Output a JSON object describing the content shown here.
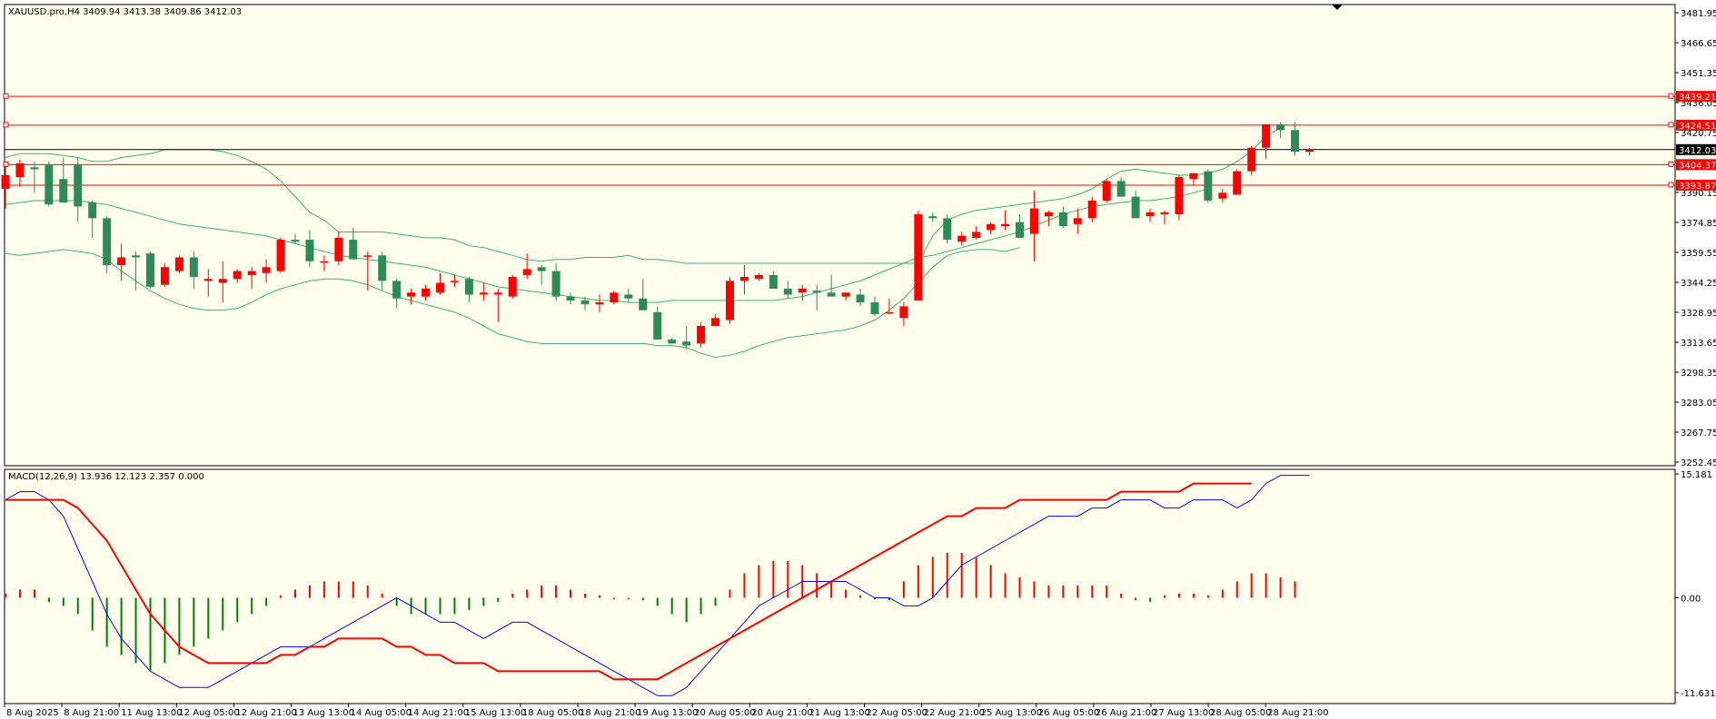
{
  "colors": {
    "background": "#FFFFEE",
    "bull": "#FF0000",
    "bear": "#2E8B57",
    "bands": "#3CB371",
    "macd_line": "#0000FF",
    "signal_line": "#FF0000",
    "hist_pos": "#FF0000",
    "hist_neg": "#008000",
    "level_line": "#FF0000",
    "current_price_line": "#000000"
  },
  "header": {
    "text": "XAUUSD.pro,H4  3409.94 3413.38 3409.86 3412.03"
  },
  "macd_header": {
    "text": "MACD(12,26,9) 13.936 12.123 2.357 0.000"
  },
  "price_axis": {
    "ticks": [
      "3481.95",
      "3466.65",
      "3451.35",
      "3436.05",
      "3420.75",
      "3405.45",
      "3390.15",
      "3374.85",
      "3359.55",
      "3344.25",
      "3328.95",
      "3313.65",
      "3298.35",
      "3283.05",
      "3267.75",
      "3252.45"
    ],
    "ylim": [
      3252.45,
      3481.95
    ]
  },
  "price_labels": {
    "current": "3412.03",
    "levels": [
      "3439.21",
      "3424.51",
      "3404.37",
      "3393.87"
    ]
  },
  "macd_axis": {
    "ticks": [
      "15.181",
      "0.00",
      "-11.631"
    ],
    "ylim": [
      -11.631,
      15.181
    ]
  },
  "time_axis": {
    "labels": [
      "8 Aug 2025",
      "8 Aug 21:00",
      "11 Aug 13:00",
      "12 Aug 05:00",
      "12 Aug 21:00",
      "13 Aug 13:00",
      "14 Aug 05:00",
      "14 Aug 21:00",
      "15 Aug 13:00",
      "18 Aug 05:00",
      "18 Aug 21:00",
      "19 Aug 13:00",
      "20 Aug 05:00",
      "20 Aug 21:00",
      "21 Aug 13:00",
      "22 Aug 05:00",
      "22 Aug 21:00",
      "25 Aug 13:00",
      "26 Aug 05:00",
      "26 Aug 21:00",
      "27 Aug 13:00",
      "28 Aug 05:00",
      "28 Aug 21:00"
    ]
  },
  "chart_data": {
    "type": "candlestick",
    "symbol": "XAUUSD.pro",
    "timeframe": "H4",
    "last_ohlc": [
      3409.94,
      3413.38,
      3409.86,
      3412.03
    ],
    "candles": [
      [
        3392,
        3404,
        3382,
        3399
      ],
      [
        3398,
        3407,
        3393,
        3405
      ],
      [
        3403,
        3406,
        3390,
        3402
      ],
      [
        3404,
        3406,
        3383,
        3384
      ],
      [
        3397,
        3408,
        3385,
        3385
      ],
      [
        3404,
        3408,
        3375,
        3383
      ],
      [
        3385,
        3386,
        3367,
        3377
      ],
      [
        3377,
        3378,
        3349,
        3353
      ],
      [
        3353,
        3364,
        3345,
        3357
      ],
      [
        3358,
        3360,
        3340,
        3357
      ],
      [
        3359,
        3360,
        3341,
        3342
      ],
      [
        3343,
        3354,
        3342,
        3352
      ],
      [
        3350,
        3358,
        3349,
        3357
      ],
      [
        3357,
        3360,
        3341,
        3347
      ],
      [
        3345,
        3351,
        3337,
        3346
      ],
      [
        3344,
        3355,
        3334,
        3346
      ],
      [
        3346,
        3351,
        3344,
        3350
      ],
      [
        3348,
        3352,
        3341,
        3350
      ],
      [
        3349,
        3356,
        3344,
        3352
      ],
      [
        3350,
        3367,
        3349,
        3366
      ],
      [
        3366,
        3369,
        3364,
        3365
      ],
      [
        3366,
        3371,
        3352,
        3355
      ],
      [
        3355,
        3358,
        3350,
        3355
      ],
      [
        3355,
        3370,
        3353,
        3367
      ],
      [
        3366,
        3372,
        3361,
        3356
      ],
      [
        3358,
        3360,
        3340,
        3358
      ],
      [
        3358,
        3360,
        3340,
        3345
      ],
      [
        3345,
        3346,
        3331,
        3336
      ],
      [
        3337,
        3341,
        3333,
        3339
      ],
      [
        3337,
        3343,
        3335,
        3341
      ],
      [
        3339,
        3349,
        3338,
        3344
      ],
      [
        3345,
        3348,
        3342,
        3345
      ],
      [
        3346,
        3347,
        3334,
        3338
      ],
      [
        3338,
        3344,
        3335,
        3339
      ],
      [
        3338,
        3341,
        3324,
        3339
      ],
      [
        3337,
        3348,
        3336,
        3347
      ],
      [
        3348,
        3359,
        3346,
        3351
      ],
      [
        3352,
        3353,
        3343,
        3350
      ],
      [
        3350,
        3354,
        3335,
        3337
      ],
      [
        3337,
        3339,
        3333,
        3335
      ],
      [
        3335,
        3337,
        3330,
        3333
      ],
      [
        3333,
        3338,
        3329,
        3334
      ],
      [
        3334,
        3340,
        3333,
        3339
      ],
      [
        3338,
        3341,
        3334,
        3336
      ],
      [
        3336,
        3346,
        3333,
        3330
      ],
      [
        3329,
        3332,
        3317,
        3315
      ],
      [
        3315,
        3316,
        3313,
        3313
      ],
      [
        3314,
        3322,
        3310,
        3312
      ],
      [
        3313,
        3324,
        3311,
        3322
      ],
      [
        3322,
        3328,
        3323,
        3326
      ],
      [
        3325,
        3347,
        3323,
        3345
      ],
      [
        3345,
        3353,
        3338,
        3347
      ],
      [
        3346,
        3349,
        3345,
        3348
      ],
      [
        3348,
        3350,
        3341,
        3341
      ],
      [
        3341,
        3345,
        3336,
        3338
      ],
      [
        3339,
        3343,
        3335,
        3341
      ],
      [
        3340,
        3343,
        3330,
        3339
      ],
      [
        3339,
        3348,
        3337,
        3337
      ],
      [
        3337,
        3339,
        3335,
        3339
      ],
      [
        3338,
        3341,
        3332,
        3334
      ],
      [
        3334,
        3337,
        3327,
        3328
      ],
      [
        3329,
        3336,
        3328,
        3329
      ],
      [
        3326,
        3334,
        3322,
        3332
      ],
      [
        3335,
        3381,
        3336,
        3379
      ],
      [
        3378,
        3380,
        3375,
        3377
      ],
      [
        3377,
        3379,
        3364,
        3366
      ],
      [
        3365,
        3370,
        3363,
        3368
      ],
      [
        3367,
        3373,
        3366,
        3370
      ],
      [
        3371,
        3375,
        3369,
        3374
      ],
      [
        3373,
        3381,
        3371,
        3374
      ],
      [
        3375,
        3379,
        3367,
        3367
      ],
      [
        3369,
        3391,
        3355,
        3382
      ],
      [
        3378,
        3381,
        3373,
        3380
      ],
      [
        3380,
        3383,
        3372,
        3373
      ],
      [
        3374,
        3382,
        3369,
        3377
      ],
      [
        3377,
        3388,
        3375,
        3386
      ],
      [
        3386,
        3397,
        3385,
        3396
      ],
      [
        3396,
        3398,
        3388,
        3388
      ],
      [
        3388,
        3391,
        3381,
        3377
      ],
      [
        3378,
        3382,
        3375,
        3380
      ],
      [
        3379,
        3381,
        3374,
        3380
      ],
      [
        3379,
        3399,
        3376,
        3398
      ],
      [
        3397,
        3400,
        3394,
        3400
      ],
      [
        3401,
        3402,
        3385,
        3386
      ],
      [
        3387,
        3392,
        3385,
        3390
      ],
      [
        3389,
        3402,
        3389,
        3401
      ],
      [
        3401,
        3414,
        3399,
        3413
      ],
      [
        3413,
        3418,
        3407,
        3425
      ],
      [
        3425,
        3426,
        3418,
        3422
      ],
      [
        3422,
        3426,
        3409,
        3411
      ],
      [
        3411,
        3413,
        3409,
        3412
      ]
    ],
    "bollinger": {
      "upper": [
        3408,
        3410,
        3410,
        3410,
        3409,
        3408,
        3406,
        3406,
        3408,
        3409,
        3410,
        3412,
        3412,
        3412,
        3412,
        3411,
        3409,
        3406,
        3402,
        3396,
        3388,
        3380,
        3376,
        3370,
        3370,
        3370,
        3370,
        3369,
        3368,
        3367,
        3367,
        3366,
        3363,
        3362,
        3360,
        3358,
        3356,
        3355,
        3356,
        3356,
        3357,
        3357,
        3357,
        3358,
        3356,
        3356,
        3355,
        3354,
        3354,
        3354,
        3354,
        3354,
        3354,
        3354,
        3354,
        3354,
        3354,
        3354,
        3354,
        3354,
        3354,
        3354,
        3354,
        3354,
        3368,
        3376,
        3379,
        3381,
        3382,
        3383,
        3384,
        3385,
        3386,
        3387,
        3389,
        3392,
        3397,
        3401,
        3402,
        3401,
        3400,
        3399,
        3399,
        3400,
        3402,
        3406,
        3411,
        3419,
        3423
      ],
      "middle": [
        3384,
        3385,
        3386,
        3386,
        3386,
        3386,
        3385,
        3384,
        3382,
        3380,
        3378,
        3376,
        3374,
        3373,
        3372,
        3371,
        3370,
        3369,
        3368,
        3366,
        3364,
        3362,
        3360,
        3358,
        3357,
        3356,
        3355,
        3354,
        3353,
        3352,
        3350,
        3348,
        3346,
        3344,
        3342,
        3341,
        3340,
        3339,
        3338,
        3337,
        3336,
        3335,
        3335,
        3334,
        3334,
        3334,
        3335,
        3335,
        3335,
        3335,
        3335,
        3335,
        3335,
        3335,
        3336,
        3337,
        3339,
        3341,
        3343,
        3345,
        3348,
        3351,
        3354,
        3357,
        3358,
        3360,
        3362,
        3364,
        3366,
        3368,
        3370,
        3373,
        3376,
        3379,
        3381,
        3383,
        3384,
        3385,
        3386,
        3386,
        3387,
        3388,
        3390,
        3392
      ],
      "lower": [
        3359,
        3358,
        3359,
        3360,
        3361,
        3360,
        3359,
        3356,
        3350,
        3345,
        3340,
        3336,
        3333,
        3331,
        3330,
        3330,
        3331,
        3334,
        3338,
        3341,
        3343,
        3345,
        3346,
        3346,
        3345,
        3343,
        3340,
        3337,
        3335,
        3333,
        3331,
        3329,
        3326,
        3322,
        3318,
        3316,
        3314,
        3313,
        3313,
        3313,
        3313,
        3313,
        3313,
        3313,
        3313,
        3312,
        3312,
        3311,
        3308,
        3306,
        3307,
        3309,
        3312,
        3314,
        3316,
        3317,
        3318,
        3319,
        3320,
        3322,
        3325,
        3330,
        3336,
        3344,
        3352,
        3358,
        3360,
        3361,
        3361,
        3360,
        3362
      ]
    },
    "macd": {
      "macd_line": [
        12,
        13,
        13,
        12,
        10,
        6,
        2,
        -2,
        -5,
        -7,
        -9,
        -10,
        -11,
        -11,
        -11,
        -10,
        -9,
        -8,
        -7,
        -6,
        -6,
        -6,
        -5,
        -4,
        -3,
        -2,
        -1,
        0,
        -1,
        -2,
        -3,
        -3,
        -4,
        -5,
        -4,
        -3,
        -3,
        -4,
        -5,
        -6,
        -7,
        -8,
        -9,
        -10,
        -11,
        -12,
        -12,
        -11,
        -9,
        -7,
        -5,
        -3,
        -1,
        0,
        1,
        2,
        2,
        2,
        2,
        1,
        0,
        0,
        -1,
        -1,
        0,
        2,
        4,
        5,
        6,
        7,
        8,
        9,
        10,
        10,
        10,
        11,
        11,
        12,
        12,
        12,
        11,
        11,
        12,
        12,
        12,
        11,
        12,
        14,
        15,
        15,
        15
      ],
      "signal_line": [
        12,
        12,
        12,
        12,
        12,
        11,
        9,
        7,
        4,
        1,
        -2,
        -4,
        -6,
        -7,
        -8,
        -8,
        -8,
        -8,
        -8,
        -7,
        -7,
        -6,
        -6,
        -5,
        -5,
        -5,
        -5,
        -6,
        -6,
        -7,
        -7,
        -8,
        -8,
        -8,
        -9,
        -9,
        -9,
        -9,
        -9,
        -9,
        -9,
        -9,
        -10,
        -10,
        -10,
        -10,
        -9,
        -8,
        -7,
        -6,
        -5,
        -4,
        -3,
        -2,
        -1,
        0,
        1,
        2,
        3,
        4,
        5,
        6,
        7,
        8,
        9,
        10,
        10,
        11,
        11,
        11,
        12,
        12,
        12,
        12,
        12,
        12,
        12,
        13,
        13,
        13,
        13,
        13,
        14,
        14,
        14,
        14,
        14
      ],
      "histogram": [
        0.5,
        1,
        1,
        -0.5,
        -1,
        -2,
        -4,
        -6,
        -7,
        -8,
        -9,
        -8,
        -7,
        -6,
        -5,
        -4,
        -3,
        -2,
        -1,
        0.3,
        1,
        1.5,
        2,
        2,
        2,
        1.5,
        0.5,
        -1,
        -2,
        -2,
        -2,
        -2,
        -1.5,
        -1,
        -0.5,
        0.5,
        1,
        1.5,
        1.5,
        1,
        0.5,
        0.3,
        -0.2,
        -0.2,
        -0.3,
        -1,
        -2,
        -3,
        -2,
        -1,
        1,
        3,
        4,
        4.5,
        4.5,
        4,
        3,
        2,
        1,
        0.3,
        -0.2,
        -0.3,
        2,
        4,
        5,
        5.5,
        5.5,
        5,
        4,
        3,
        2.5,
        2,
        1.5,
        1.5,
        1.5,
        1.5,
        1.5,
        0.5,
        -0.3,
        -0.5,
        0.3,
        0.5,
        0.5,
        0.3,
        1,
        2,
        3,
        3,
        2.5,
        2
      ]
    }
  }
}
